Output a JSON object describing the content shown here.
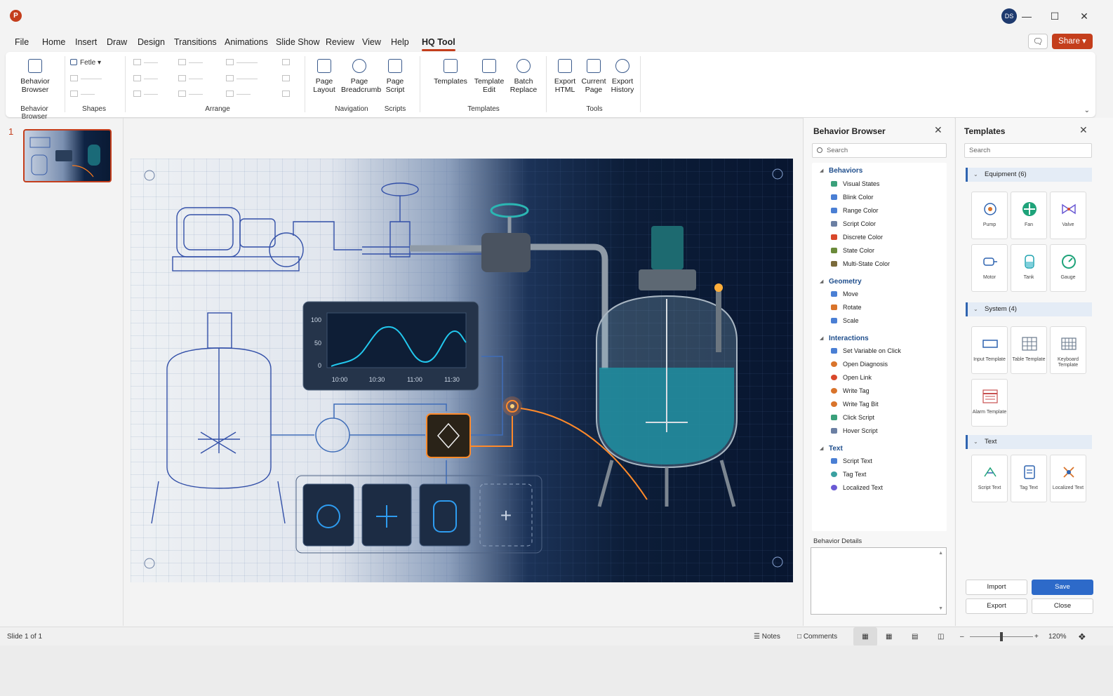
{
  "titlebar": {
    "app_logo": "P",
    "avatar_initials": "DS"
  },
  "menu": {
    "tabs": [
      "File",
      "Home",
      "Insert",
      "Draw",
      "Design",
      "Transitions",
      "Animations",
      "Slide Show",
      "Review",
      "View",
      "Help",
      "HQ Tool"
    ],
    "active": "HQ Tool"
  },
  "share_label": "Share",
  "ribbon": {
    "behavior_browser": "Behavior Browser",
    "shape_font": "Fetle",
    "groups": {
      "behavior_browser": "Behavior Browser",
      "shapes": "Shapes",
      "arrange": "Arrange",
      "navigation": "Navigation",
      "scripts": "Scripts",
      "templates": "Templates",
      "tools": "Tools"
    },
    "page_layout": "Page Layout",
    "page_breadcrumb": "Page Breadcrumb",
    "page_script": "Page Script",
    "templates": "Templates",
    "template_edit": "Template Edit",
    "batch_replace": "Batch Replace",
    "export_html": "Export HTML",
    "current_page": "Current Page",
    "export_history": "Export History"
  },
  "thumbnails": {
    "slide_number": "1"
  },
  "slide": {
    "chart_y_ticks": [
      "100",
      "50",
      "0"
    ],
    "chart_x_ticks": [
      "10:00",
      "10:30",
      "11:00",
      "11:30"
    ],
    "add_tile": "+"
  },
  "behavior_browser": {
    "title": "Behavior Browser",
    "search_placeholder": "Search",
    "categories": [
      {
        "name": "Behaviors",
        "items": [
          "Visual States",
          "Blink Color",
          "Range Color",
          "Script Color",
          "Discrete Color",
          "State Color",
          "Multi-State Color"
        ]
      },
      {
        "name": "Geometry",
        "items": [
          "Move",
          "Rotate",
          "Scale"
        ]
      },
      {
        "name": "Interactions",
        "items": [
          "Set Variable on Click",
          "Open Diagnosis",
          "Open Link",
          "Write Tag",
          "Write Tag Bit",
          "Click Script",
          "Hover Script"
        ]
      },
      {
        "name": "Text",
        "items": [
          "Script Text",
          "Tag Text",
          "Localized Text"
        ]
      }
    ],
    "details_label": "Behavior Details"
  },
  "templates_panel": {
    "title": "Templates",
    "search_placeholder": "Search",
    "sections": [
      {
        "name": "Equipment (6)",
        "items": [
          "Pump",
          "Fan",
          "Valve",
          "Motor",
          "Tank",
          "Gauge"
        ]
      },
      {
        "name": "System (4)",
        "items": [
          "Input Template",
          "Table Template",
          "Keyboard Template",
          "Alarm Template"
        ]
      },
      {
        "name": "Text",
        "items": [
          "Script Text",
          "Tag Text",
          "Localized Text"
        ]
      }
    ],
    "buttons": {
      "import": "Import",
      "save": "Save",
      "export": "Export",
      "close": "Close"
    }
  },
  "statusbar": {
    "slide_info": "Slide 1 of 1",
    "notes": "Notes",
    "comments": "Comments",
    "zoom": "120%"
  },
  "colors": {
    "accent": "#c43e1c",
    "primary_button": "#2d6ac9",
    "category_text": "#1f4e8c"
  }
}
